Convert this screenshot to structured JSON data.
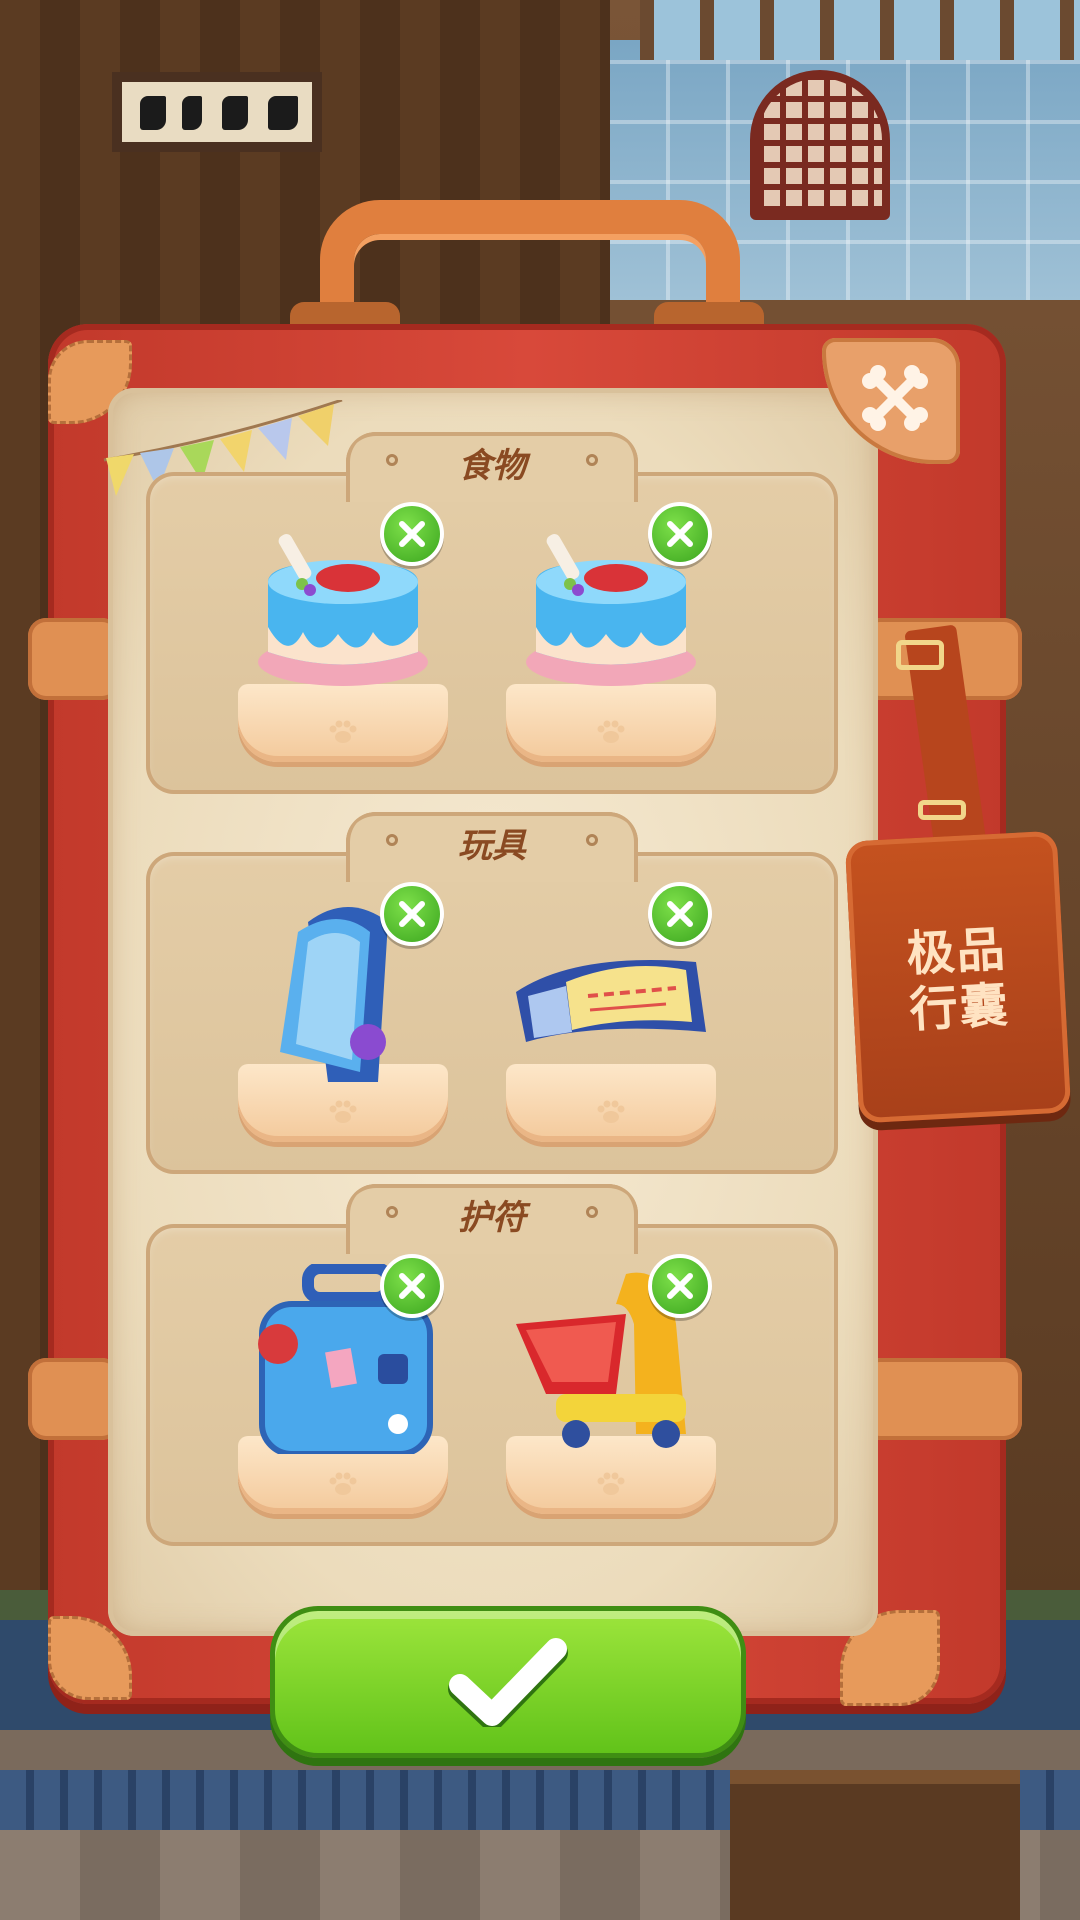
{
  "sections": [
    {
      "title": "食物",
      "items": [
        {
          "name": "blue-cake",
          "icon": "cake-icon"
        },
        {
          "name": "blue-cake",
          "icon": "cake-icon"
        }
      ]
    },
    {
      "title": "玩具",
      "items": [
        {
          "name": "phone-toy",
          "icon": "phone-toy-icon"
        },
        {
          "name": "ticket-toy",
          "icon": "ticket-icon"
        }
      ]
    },
    {
      "title": "护符",
      "items": [
        {
          "name": "luggage-charm",
          "icon": "luggage-icon"
        },
        {
          "name": "cart-charm",
          "icon": "shopping-cart-icon"
        }
      ]
    }
  ],
  "tag": {
    "line1": "极品",
    "line2": "行囊"
  },
  "colors": {
    "case": "#c2392b",
    "accent_green": "#62c31a",
    "title": "#8a4a22"
  }
}
